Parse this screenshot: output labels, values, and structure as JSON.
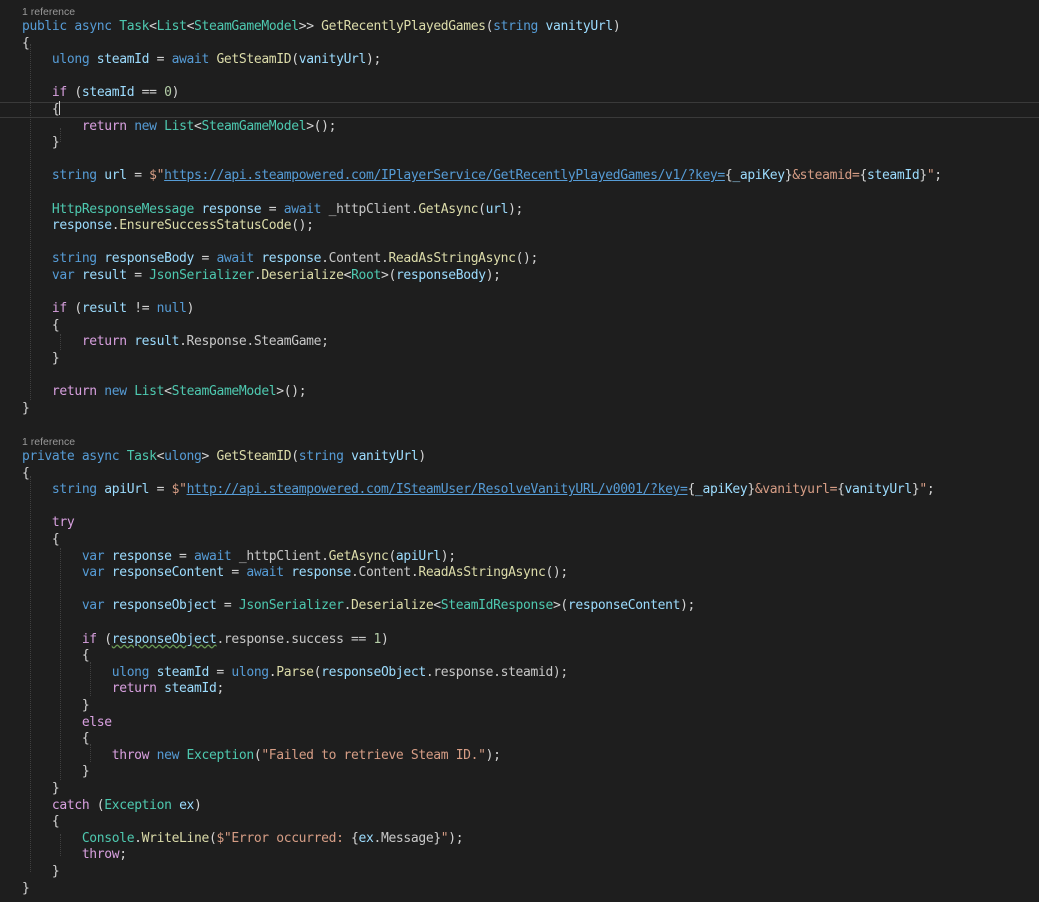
{
  "editor": {
    "colors": {
      "background": "#1e1e1e",
      "keyword": "#569cd6",
      "control": "#d8a0df",
      "type": "#4ec9b0",
      "method": "#dcdcaa",
      "identifier": "#9cdcfe",
      "string": "#d69d85",
      "number": "#b5cea8"
    },
    "codelens": [
      "1 reference",
      "1 reference"
    ],
    "lines": [
      [
        [
          "public",
          "kw"
        ],
        [
          " ",
          ""
        ],
        [
          "async",
          "kw"
        ],
        [
          " ",
          ""
        ],
        [
          "Task",
          "typ"
        ],
        [
          "<",
          "pun"
        ],
        [
          "List",
          "typ"
        ],
        [
          "<",
          "pun"
        ],
        [
          "SteamGameModel",
          "typ"
        ],
        [
          ">> ",
          "pun"
        ],
        [
          "GetRecentlyPlayedGames",
          "fn"
        ],
        [
          "(",
          "pun"
        ],
        [
          "string",
          "kw"
        ],
        [
          " ",
          ""
        ],
        [
          "vanityUrl",
          "var"
        ],
        [
          ")",
          "pun"
        ]
      ],
      [
        [
          "{",
          "pun"
        ]
      ],
      [
        [
          "    ",
          ""
        ],
        [
          "ulong",
          "kw"
        ],
        [
          " ",
          ""
        ],
        [
          "steamId",
          "var"
        ],
        [
          " = ",
          "pun"
        ],
        [
          "await",
          "kw"
        ],
        [
          " ",
          ""
        ],
        [
          "GetSteamID",
          "fn"
        ],
        [
          "(",
          "pun"
        ],
        [
          "vanityUrl",
          "var"
        ],
        [
          ");",
          "pun"
        ]
      ],
      [],
      [
        [
          "    ",
          ""
        ],
        [
          "if",
          "ctl"
        ],
        [
          " (",
          "pun"
        ],
        [
          "steamId",
          "var"
        ],
        [
          " == ",
          "pun"
        ],
        [
          "0",
          "num"
        ],
        [
          ")",
          "pun"
        ]
      ],
      [
        [
          "    ",
          ""
        ],
        [
          "{",
          "pun"
        ]
      ],
      [
        [
          "        ",
          ""
        ],
        [
          "return",
          "ctl"
        ],
        [
          " ",
          ""
        ],
        [
          "new",
          "kw"
        ],
        [
          " ",
          ""
        ],
        [
          "List",
          "typ"
        ],
        [
          "<",
          "pun"
        ],
        [
          "SteamGameModel",
          "typ"
        ],
        [
          ">();",
          "pun"
        ]
      ],
      [
        [
          "    ",
          ""
        ],
        [
          "}",
          "pun"
        ]
      ],
      [],
      [
        [
          "    ",
          ""
        ],
        [
          "string",
          "kw"
        ],
        [
          " ",
          ""
        ],
        [
          "url",
          "var"
        ],
        [
          " = ",
          "pun"
        ],
        [
          "$\"",
          "str"
        ],
        [
          "https://api.steampowered.com/IPlayerService/GetRecentlyPlayedGames/v1/?key=",
          "url"
        ],
        [
          "{",
          "pun"
        ],
        [
          "_apiKey",
          "var"
        ],
        [
          "}",
          "pun"
        ],
        [
          "&steamid=",
          "str"
        ],
        [
          "{",
          "pun"
        ],
        [
          "steamId",
          "var"
        ],
        [
          "}",
          "pun"
        ],
        [
          "\"",
          "str"
        ],
        [
          ";",
          "pun"
        ]
      ],
      [],
      [
        [
          "    ",
          ""
        ],
        [
          "HttpResponseMessage",
          "typ"
        ],
        [
          " ",
          ""
        ],
        [
          "response",
          "var"
        ],
        [
          " = ",
          "pun"
        ],
        [
          "await",
          "kw"
        ],
        [
          " _httpClient.",
          "prop"
        ],
        [
          "GetAsync",
          "fn"
        ],
        [
          "(",
          "pun"
        ],
        [
          "url",
          "var"
        ],
        [
          ");",
          "pun"
        ]
      ],
      [
        [
          "    ",
          ""
        ],
        [
          "response",
          "var"
        ],
        [
          ".",
          "pun"
        ],
        [
          "EnsureSuccessStatusCode",
          "fn"
        ],
        [
          "();",
          "pun"
        ]
      ],
      [],
      [
        [
          "    ",
          ""
        ],
        [
          "string",
          "kw"
        ],
        [
          " ",
          ""
        ],
        [
          "responseBody",
          "var"
        ],
        [
          " = ",
          "pun"
        ],
        [
          "await",
          "kw"
        ],
        [
          " ",
          ""
        ],
        [
          "response",
          "var"
        ],
        [
          ".Content.",
          "prop"
        ],
        [
          "ReadAsStringAsync",
          "fn"
        ],
        [
          "();",
          "pun"
        ]
      ],
      [
        [
          "    ",
          ""
        ],
        [
          "var",
          "kw"
        ],
        [
          " ",
          ""
        ],
        [
          "result",
          "var"
        ],
        [
          " = ",
          "pun"
        ],
        [
          "JsonSerializer",
          "typ"
        ],
        [
          ".",
          "pun"
        ],
        [
          "Deserialize",
          "fn"
        ],
        [
          "<",
          "pun"
        ],
        [
          "Root",
          "typ"
        ],
        [
          ">(",
          "pun"
        ],
        [
          "responseBody",
          "var"
        ],
        [
          ");",
          "pun"
        ]
      ],
      [],
      [
        [
          "    ",
          ""
        ],
        [
          "if",
          "ctl"
        ],
        [
          " (",
          "pun"
        ],
        [
          "result",
          "var"
        ],
        [
          " != ",
          "pun"
        ],
        [
          "null",
          "kw"
        ],
        [
          ")",
          "pun"
        ]
      ],
      [
        [
          "    ",
          ""
        ],
        [
          "{",
          "pun"
        ]
      ],
      [
        [
          "        ",
          ""
        ],
        [
          "return",
          "ctl"
        ],
        [
          " ",
          ""
        ],
        [
          "result",
          "var"
        ],
        [
          ".Response.SteamGame;",
          "prop"
        ]
      ],
      [
        [
          "    ",
          ""
        ],
        [
          "}",
          "pun"
        ]
      ],
      [],
      [
        [
          "    ",
          ""
        ],
        [
          "return",
          "ctl"
        ],
        [
          " ",
          ""
        ],
        [
          "new",
          "kw"
        ],
        [
          " ",
          ""
        ],
        [
          "List",
          "typ"
        ],
        [
          "<",
          "pun"
        ],
        [
          "SteamGameModel",
          "typ"
        ],
        [
          ">();",
          "pun"
        ]
      ],
      [
        [
          "}",
          "pun"
        ]
      ],
      [
        [
          "private",
          "kw"
        ],
        [
          " ",
          ""
        ],
        [
          "async",
          "kw"
        ],
        [
          " ",
          ""
        ],
        [
          "Task",
          "typ"
        ],
        [
          "<",
          "pun"
        ],
        [
          "ulong",
          "kw"
        ],
        [
          "> ",
          "pun"
        ],
        [
          "GetSteamID",
          "fn"
        ],
        [
          "(",
          "pun"
        ],
        [
          "string",
          "kw"
        ],
        [
          " ",
          ""
        ],
        [
          "vanityUrl",
          "var"
        ],
        [
          ")",
          "pun"
        ]
      ],
      [
        [
          "{",
          "pun"
        ]
      ],
      [
        [
          "    ",
          ""
        ],
        [
          "string",
          "kw"
        ],
        [
          " ",
          ""
        ],
        [
          "apiUrl",
          "var"
        ],
        [
          " = ",
          "pun"
        ],
        [
          "$\"",
          "str"
        ],
        [
          "http://api.steampowered.com/ISteamUser/ResolveVanityURL/v0001/?key=",
          "url"
        ],
        [
          "{",
          "pun"
        ],
        [
          "_apiKey",
          "var"
        ],
        [
          "}",
          "pun"
        ],
        [
          "&vanityurl=",
          "str"
        ],
        [
          "{",
          "pun"
        ],
        [
          "vanityUrl",
          "var"
        ],
        [
          "}",
          "pun"
        ],
        [
          "\"",
          "str"
        ],
        [
          ";",
          "pun"
        ]
      ],
      [],
      [
        [
          "    ",
          ""
        ],
        [
          "try",
          "ctl"
        ]
      ],
      [
        [
          "    ",
          ""
        ],
        [
          "{",
          "pun"
        ]
      ],
      [
        [
          "        ",
          ""
        ],
        [
          "var",
          "kw"
        ],
        [
          " ",
          ""
        ],
        [
          "response",
          "var"
        ],
        [
          " = ",
          "pun"
        ],
        [
          "await",
          "kw"
        ],
        [
          " _httpClient.",
          "prop"
        ],
        [
          "GetAsync",
          "fn"
        ],
        [
          "(",
          "pun"
        ],
        [
          "apiUrl",
          "var"
        ],
        [
          ");",
          "pun"
        ]
      ],
      [
        [
          "        ",
          ""
        ],
        [
          "var",
          "kw"
        ],
        [
          " ",
          ""
        ],
        [
          "responseContent",
          "var"
        ],
        [
          " = ",
          "pun"
        ],
        [
          "await",
          "kw"
        ],
        [
          " ",
          ""
        ],
        [
          "response",
          "var"
        ],
        [
          ".Content.",
          "prop"
        ],
        [
          "ReadAsStringAsync",
          "fn"
        ],
        [
          "();",
          "pun"
        ]
      ],
      [],
      [
        [
          "        ",
          ""
        ],
        [
          "var",
          "kw"
        ],
        [
          " ",
          ""
        ],
        [
          "responseObject",
          "var"
        ],
        [
          " = ",
          "pun"
        ],
        [
          "JsonSerializer",
          "typ"
        ],
        [
          ".",
          "pun"
        ],
        [
          "Deserialize",
          "fn"
        ],
        [
          "<",
          "pun"
        ],
        [
          "SteamIdResponse",
          "typ"
        ],
        [
          ">(",
          "pun"
        ],
        [
          "responseContent",
          "var"
        ],
        [
          ");",
          "pun"
        ]
      ],
      [],
      [
        [
          "        ",
          ""
        ],
        [
          "if",
          "ctl"
        ],
        [
          " (",
          "pun"
        ],
        [
          "responseObject",
          "var squig"
        ],
        [
          ".response.success == ",
          "prop"
        ],
        [
          "1",
          "num"
        ],
        [
          ")",
          "pun"
        ]
      ],
      [
        [
          "        ",
          ""
        ],
        [
          "{",
          "pun"
        ]
      ],
      [
        [
          "            ",
          ""
        ],
        [
          "ulong",
          "kw"
        ],
        [
          " ",
          ""
        ],
        [
          "steamId",
          "var"
        ],
        [
          " = ",
          "pun"
        ],
        [
          "ulong",
          "kw"
        ],
        [
          ".",
          "pun"
        ],
        [
          "Parse",
          "fn"
        ],
        [
          "(",
          "pun"
        ],
        [
          "responseObject",
          "var"
        ],
        [
          ".response.steamid);",
          "prop"
        ]
      ],
      [
        [
          "            ",
          ""
        ],
        [
          "return",
          "ctl"
        ],
        [
          " ",
          ""
        ],
        [
          "steamId",
          "var"
        ],
        [
          ";",
          "pun"
        ]
      ],
      [
        [
          "        ",
          ""
        ],
        [
          "}",
          "pun"
        ]
      ],
      [
        [
          "        ",
          ""
        ],
        [
          "else",
          "ctl"
        ]
      ],
      [
        [
          "        ",
          ""
        ],
        [
          "{",
          "pun"
        ]
      ],
      [
        [
          "            ",
          ""
        ],
        [
          "throw",
          "ctl"
        ],
        [
          " ",
          ""
        ],
        [
          "new",
          "kw"
        ],
        [
          " ",
          ""
        ],
        [
          "Exception",
          "typ"
        ],
        [
          "(",
          "pun"
        ],
        [
          "\"Failed to retrieve Steam ID.\"",
          "str"
        ],
        [
          ");",
          "pun"
        ]
      ],
      [
        [
          "        ",
          ""
        ],
        [
          "}",
          "pun"
        ]
      ],
      [
        [
          "    ",
          ""
        ],
        [
          "}",
          "pun"
        ]
      ],
      [
        [
          "    ",
          ""
        ],
        [
          "catch",
          "ctl"
        ],
        [
          " (",
          "pun"
        ],
        [
          "Exception",
          "typ"
        ],
        [
          " ",
          ""
        ],
        [
          "ex",
          "var"
        ],
        [
          ")",
          "pun"
        ]
      ],
      [
        [
          "    ",
          ""
        ],
        [
          "{",
          "pun"
        ]
      ],
      [
        [
          "        ",
          ""
        ],
        [
          "Console",
          "typ"
        ],
        [
          ".",
          "pun"
        ],
        [
          "WriteLine",
          "fn"
        ],
        [
          "(",
          "pun"
        ],
        [
          "$\"Error occurred: ",
          "str"
        ],
        [
          "{",
          "pun"
        ],
        [
          "ex",
          "var"
        ],
        [
          ".Message",
          "prop"
        ],
        [
          "}",
          "pun"
        ],
        [
          "\"",
          "str"
        ],
        [
          ");",
          "pun"
        ]
      ],
      [
        [
          "        ",
          ""
        ],
        [
          "throw",
          "ctl"
        ],
        [
          ";",
          "pun"
        ]
      ],
      [
        [
          "    ",
          ""
        ],
        [
          "}",
          "pun"
        ]
      ],
      [
        [
          "}",
          "pun"
        ]
      ]
    ]
  }
}
